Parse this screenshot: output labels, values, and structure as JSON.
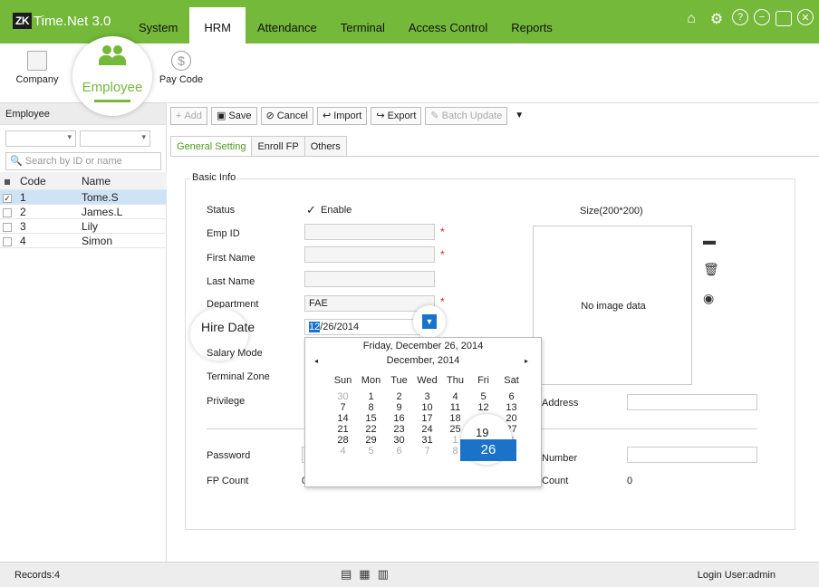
{
  "app": {
    "logo_mark": "ZK",
    "logo_name": "Time.Net 3.0"
  },
  "nav": [
    {
      "label": "System",
      "active": false
    },
    {
      "label": "HRM",
      "active": true
    },
    {
      "label": "Attendance",
      "active": false
    },
    {
      "label": "Terminal",
      "active": false
    },
    {
      "label": "Access Control",
      "active": false
    },
    {
      "label": "Reports",
      "active": false
    }
  ],
  "window_icons": [
    "home-icon",
    "settings-icon",
    "help-icon",
    "minimize-icon",
    "maximize-icon",
    "close-icon"
  ],
  "modules": {
    "company": "Company",
    "employee": "Employee",
    "paycode": "Pay Code"
  },
  "left": {
    "title": "Employee",
    "search_placeholder": "Search by ID or name",
    "headers": [
      "Code",
      "Name"
    ],
    "rows": [
      {
        "code": "1",
        "name": "Tome.S",
        "checked": true
      },
      {
        "code": "2",
        "name": "James.L",
        "checked": false
      },
      {
        "code": "3",
        "name": "Lily",
        "checked": false
      },
      {
        "code": "4",
        "name": "Simon",
        "checked": false
      }
    ]
  },
  "toolbar": {
    "add": "Add",
    "save": "Save",
    "cancel": "Cancel",
    "import": "Import",
    "export": "Export",
    "batch_update": "Batch Update"
  },
  "tabs": [
    "General Setting",
    "Enroll FP",
    "Others"
  ],
  "form": {
    "group_title": "Basic Info",
    "status_label": "Status",
    "status_value": "Enable",
    "emp_id_label": "Emp ID",
    "first_name_label": "First Name",
    "last_name_label": "Last Name",
    "department_label": "Department",
    "department_value": "FAE",
    "hire_date_label": "Hire Date",
    "hire_date_month": "12",
    "hire_date_rest": "/26/2014",
    "salary_mode_label": "Salary Mode",
    "terminal_zone_label": "Terminal Zone",
    "privilege_label": "Privilege",
    "password_label": "Password",
    "fp_count_label": "FP Count",
    "fp_count_value": "0",
    "address_label": "Address",
    "number_label": "Number",
    "count_label": "Count",
    "count_value": "0",
    "size_label": "Size(200*200)",
    "no_image": "No image data"
  },
  "calendar": {
    "today_text": "Friday, December 26, 2014",
    "month_text": "December, 2014",
    "dow": [
      "Sun",
      "Mon",
      "Tue",
      "Wed",
      "Thu",
      "Fri",
      "Sat"
    ],
    "weeks": [
      [
        {
          "d": "30",
          "o": true
        },
        {
          "d": "1"
        },
        {
          "d": "2"
        },
        {
          "d": "3"
        },
        {
          "d": "4"
        },
        {
          "d": "5"
        },
        {
          "d": "6"
        }
      ],
      [
        {
          "d": "7"
        },
        {
          "d": "8"
        },
        {
          "d": "9"
        },
        {
          "d": "10"
        },
        {
          "d": "11"
        },
        {
          "d": "12"
        },
        {
          "d": "13"
        }
      ],
      [
        {
          "d": "14"
        },
        {
          "d": "15"
        },
        {
          "d": "16"
        },
        {
          "d": "17"
        },
        {
          "d": "18"
        },
        {
          "d": "19"
        },
        {
          "d": "20"
        }
      ],
      [
        {
          "d": "21"
        },
        {
          "d": "22"
        },
        {
          "d": "23"
        },
        {
          "d": "24"
        },
        {
          "d": "25"
        },
        {
          "d": "26"
        },
        {
          "d": "27"
        }
      ],
      [
        {
          "d": "28"
        },
        {
          "d": "29"
        },
        {
          "d": "30"
        },
        {
          "d": "31"
        },
        {
          "d": "1",
          "o": true
        },
        {
          "d": "2",
          "o": true
        },
        {
          "d": "3",
          "o": true
        }
      ],
      [
        {
          "d": "4",
          "o": true
        },
        {
          "d": "5",
          "o": true
        },
        {
          "d": "6",
          "o": true
        },
        {
          "d": "7",
          "o": true
        },
        {
          "d": "8",
          "o": true
        },
        {
          "d": "9",
          "o": true
        },
        {
          "d": "10",
          "o": true
        }
      ]
    ],
    "selected_day": "26"
  },
  "status": {
    "records": "Records:4",
    "user": "Login User:admin"
  }
}
